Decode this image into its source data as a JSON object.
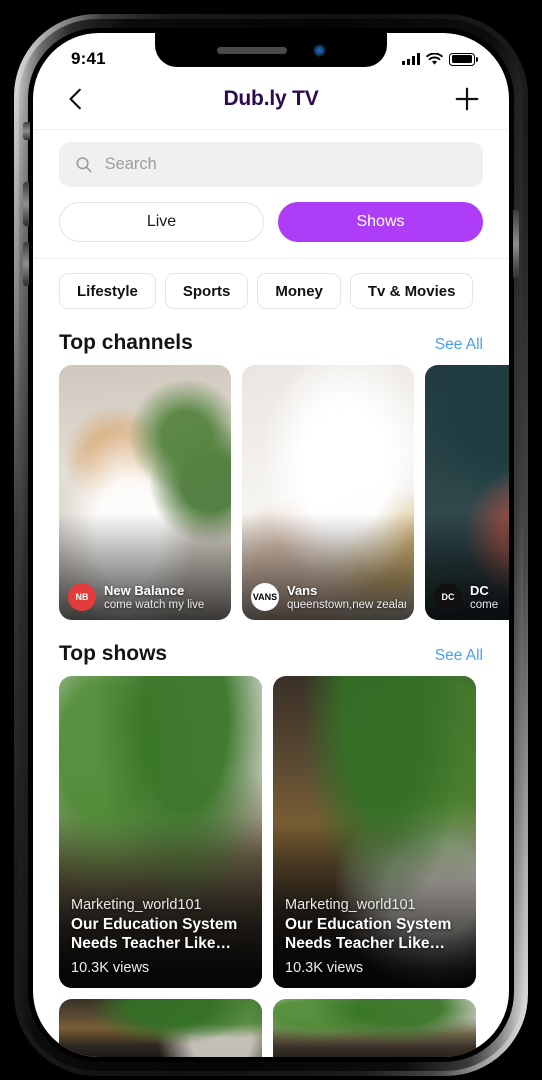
{
  "status_bar": {
    "time": "9:41",
    "signal_icon": "signal-bars-icon",
    "wifi_icon": "wifi-icon",
    "battery_icon": "battery-full-icon"
  },
  "header": {
    "title": "Dub.ly TV",
    "back_icon": "chevron-left-icon",
    "add_icon": "plus-icon",
    "title_color": "#2c0a4d"
  },
  "search": {
    "placeholder": "Search",
    "value": "",
    "icon": "search-icon"
  },
  "segmented": {
    "accent_color": "#ae3df7",
    "options": [
      {
        "label": "Live",
        "active": false
      },
      {
        "label": "Shows",
        "active": true
      }
    ]
  },
  "chips": [
    {
      "label": "Lifestyle"
    },
    {
      "label": "Sports"
    },
    {
      "label": "Money"
    },
    {
      "label": "Tv & Movies"
    }
  ],
  "sections": [
    {
      "title": "Top channels",
      "see_all": "See All",
      "see_all_color": "#4a9ff5",
      "cards": [
        {
          "name": "New Balance",
          "subtitle": "come watch my live",
          "logo_text": "NB",
          "logo_class": "logo-nb",
          "photo_class": "ph-nb"
        },
        {
          "name": "Vans",
          "subtitle": "queenstown,new zealand",
          "logo_text": "VANS",
          "logo_class": "logo-vans",
          "photo_class": "ph-vans"
        },
        {
          "name": "DC",
          "subtitle": "come",
          "logo_text": "DC",
          "logo_class": "logo-dc",
          "photo_class": "ph-dc"
        }
      ]
    },
    {
      "title": "Top shows",
      "see_all": "See All",
      "see_all_color": "#4a9ff5",
      "cards": [
        {
          "author": "Marketing_world101",
          "title": "Our Education System Needs Teacher Like…",
          "views": "10.3K views",
          "photo_class": "ph-cafe1"
        },
        {
          "author": "Marketing_world101",
          "title": "Our Education System Needs Teacher Like…",
          "views": "10.3K views",
          "photo_class": "ph-cafe2"
        }
      ]
    }
  ]
}
